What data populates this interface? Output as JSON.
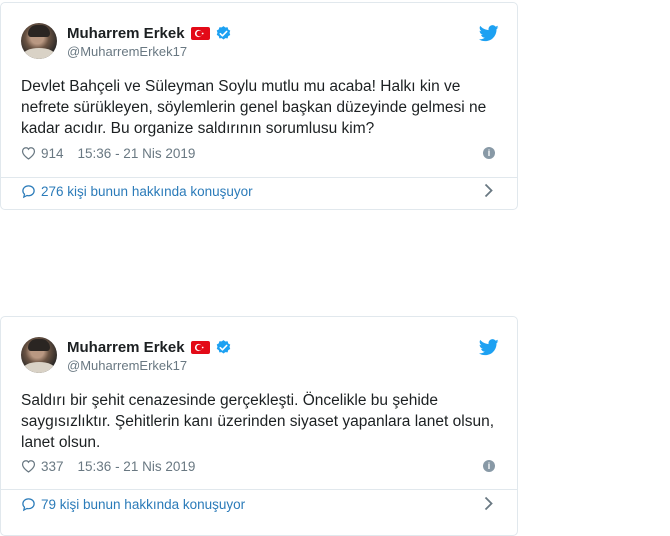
{
  "tweets": [
    {
      "author_name": "Muharrem Erkek",
      "handle": "@MuharremErkek17",
      "text": "Devlet Bahçeli ve Süleyman Soylu mutlu mu acaba! Halkı kin ve nefrete sürükleyen, söylemlerin genel başkan düzeyinde gelmesi ne kadar acıdır. Bu organize saldırının sorumlusu kim?",
      "likes": "914",
      "timestamp": "15:36 - 21 Nis 2019",
      "discussion": "276 kişi bunun hakkında konuşuyor"
    },
    {
      "author_name": "Muharrem Erkek",
      "handle": "@MuharremErkek17",
      "text": "Saldırı bir şehit cenazesinde gerçekleşti. Öncelikle bu şehide saygısızlıktır. Şehitlerin kanı üzerinden siyaset yapanlara lanet olsun, lanet olsun.",
      "likes": "337",
      "timestamp": "15:36 - 21 Nis 2019",
      "discussion": "79 kişi bunun hakkında konuşuyor"
    }
  ],
  "icons": {
    "brand": "twitter-bird-icon",
    "verified": "verified-badge-icon",
    "flag": "turkey-flag-icon",
    "like": "heart-icon",
    "info": "info-icon",
    "discussion": "speech-bubble-icon",
    "more": "chevron-right-icon"
  },
  "colors": {
    "twitter_blue": "#1da1f2",
    "link_blue": "#2b7bb9",
    "secondary_text": "#697882",
    "border": "#e1e8ed",
    "flag_red": "#e30a17"
  }
}
